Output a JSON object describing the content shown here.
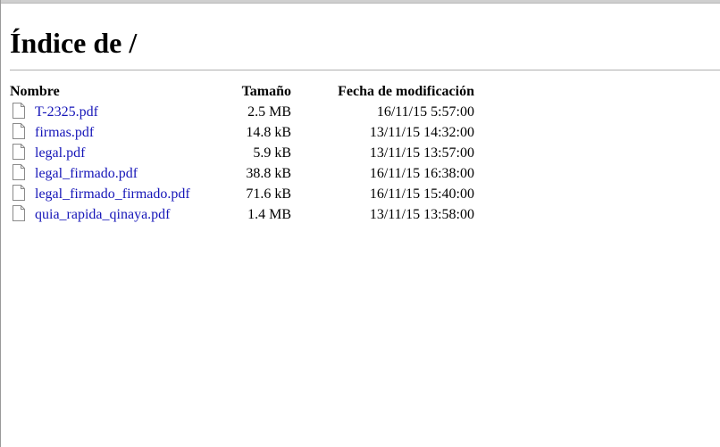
{
  "page": {
    "title": "Índice de /"
  },
  "table": {
    "headers": {
      "name": "Nombre",
      "size": "Tamaño",
      "date": "Fecha de modificación"
    },
    "rows": [
      {
        "name": "T-2325.pdf",
        "size": "2.5 MB",
        "date": "16/11/15 5:57:00",
        "icon": "file-icon"
      },
      {
        "name": "firmas.pdf",
        "size": "14.8 kB",
        "date": "13/11/15 14:32:00",
        "icon": "file-icon"
      },
      {
        "name": "legal.pdf",
        "size": "5.9 kB",
        "date": "13/11/15 13:57:00",
        "icon": "file-icon"
      },
      {
        "name": "legal_firmado.pdf",
        "size": "38.8 kB",
        "date": "16/11/15 16:38:00",
        "icon": "file-icon"
      },
      {
        "name": "legal_firmado_firmado.pdf",
        "size": "71.6 kB",
        "date": "16/11/15 15:40:00",
        "icon": "file-icon"
      },
      {
        "name": "quia_rapida_qinaya.pdf",
        "size": "1.4 MB",
        "date": "13/11/15 13:58:00",
        "icon": "file-icon"
      }
    ]
  },
  "colors": {
    "link": "#1515b8",
    "rule": "#b0b0b0"
  }
}
